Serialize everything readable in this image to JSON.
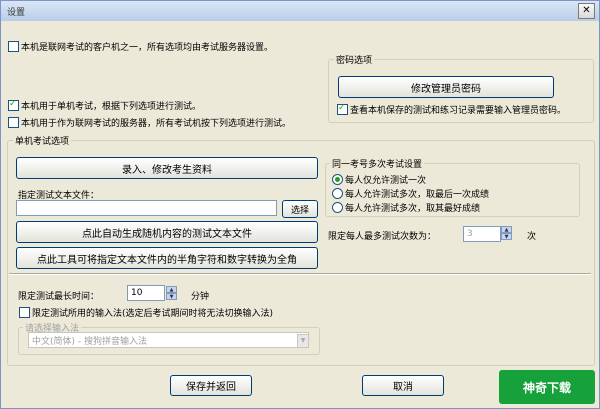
{
  "window": {
    "title": "设置",
    "close_label": "✕"
  },
  "client_mode": {
    "label": "本机是联网考试的客户机之一，所有选项均由考试服务器设置。",
    "checked": false
  },
  "password_group": {
    "title": "密码选项",
    "change_password_label": "修改管理员密码",
    "require_password_label": "查看本机保存的测试和练习记录需要输入管理员密码。",
    "require_password_checked": true
  },
  "single_mode": {
    "label": "本机用于单机考试，根据下列选项进行测试。",
    "checked": true
  },
  "server_mode": {
    "label": "本机用于作为联网考试的服务器，所有考试机按下列选项进行测试。",
    "checked": false
  },
  "single_group": {
    "title": "单机考试选项",
    "enter_students_label": "录入、修改考生资料",
    "text_file_label": "指定测试文本文件：",
    "text_file_value": "",
    "choose_label": "选择",
    "auto_generate_label": "点此自动生成随机内容的测试文本文件",
    "convert_label": "点此工具可将指定文本文件内的半角字符和数字转换为全角"
  },
  "multi_group": {
    "title": "同一考号多次考试设置",
    "options": [
      {
        "label": "每人仅允许测试一次",
        "checked": true
      },
      {
        "label": "每人允许测试多次，取最后一次成绩",
        "checked": false
      },
      {
        "label": "每人允许测试多次，取其最好成绩",
        "checked": false
      }
    ],
    "max_tests_label": "限定每人最多测试次数为：",
    "max_tests_value": "3",
    "max_tests_unit": "次"
  },
  "time_limit": {
    "label": "限定测试最长时间：",
    "value": "10",
    "unit": "分钟"
  },
  "ime_limit": {
    "label": "限定测试所用的输入法(选定后考试期间时将无法切换输入法)",
    "checked": false
  },
  "ime_group": {
    "title": "请选择输入法",
    "selected": "中文(简体) - 搜狗拼音输入法"
  },
  "footer": {
    "save_label": "保存并返回",
    "cancel_label": "取消"
  },
  "watermark": {
    "text": "神奇下载"
  }
}
